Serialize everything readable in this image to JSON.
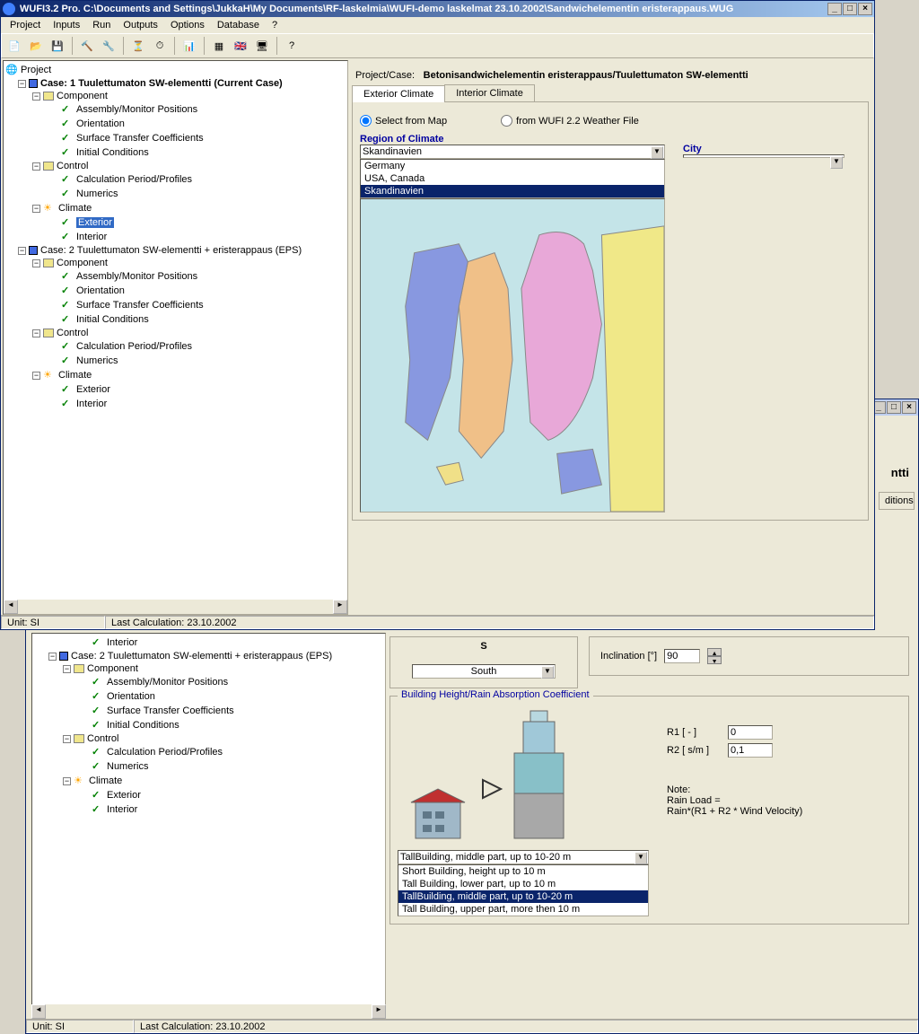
{
  "window1": {
    "title": "WUFI3.2 Pro.    C:\\Documents and Settings\\JukkaH\\My Documents\\RF-laskelmia\\WUFI-demo laskelmat 23.10.2002\\Sandwichelementin eristerappaus.WUG",
    "menu": [
      "Project",
      "Inputs",
      "Run",
      "Outputs",
      "Options",
      "Database",
      "?"
    ],
    "tree": {
      "root": "Project",
      "case1": {
        "label": "Case: 1 Tuulettumaton SW-elementti  (Current Case)",
        "component": {
          "label": "Component",
          "items": [
            "Assembly/Monitor Positions",
            "Orientation",
            "Surface Transfer Coefficients",
            "Initial Conditions"
          ]
        },
        "control": {
          "label": "Control",
          "items": [
            "Calculation Period/Profiles",
            "Numerics"
          ]
        },
        "climate": {
          "label": "Climate",
          "items": [
            "Exterior",
            "Interior"
          ]
        }
      },
      "case2": {
        "label": "Case: 2 Tuulettumaton SW-elementti + eristerappaus (EPS)",
        "component": {
          "label": "Component",
          "items": [
            "Assembly/Monitor Positions",
            "Orientation",
            "Surface Transfer Coefficients",
            "Initial Conditions"
          ]
        },
        "control": {
          "label": "Control",
          "items": [
            "Calculation Period/Profiles",
            "Numerics"
          ]
        },
        "climate": {
          "label": "Climate",
          "items": [
            "Exterior",
            "Interior"
          ]
        }
      }
    },
    "projectCase": {
      "prefix": "Project/Case:",
      "value": "Betonisandwichelementin eristerappaus/Tuulettumaton SW-elementti"
    },
    "tabs": {
      "exterior": "Exterior Climate",
      "interior": "Interior Climate"
    },
    "radio": {
      "map": "Select from Map",
      "file": "from WUFI 2.2 Weather File"
    },
    "region": {
      "label": "Region of Climate",
      "selected": "Skandinavien",
      "options": [
        "Germany",
        "USA, Canada",
        "Skandinavien"
      ]
    },
    "city": {
      "label": "City",
      "selected": ""
    },
    "status": {
      "unit": "Unit:  SI",
      "lastCalc": "Last Calculation: 23.10.2002"
    }
  },
  "window2": {
    "tree": {
      "interior": "Interior",
      "case2": {
        "label": "Case: 2 Tuulettumaton SW-elementti + eristerappaus (EPS)",
        "component": {
          "label": "Component",
          "items": [
            "Assembly/Monitor Positions",
            "Orientation",
            "Surface Transfer Coefficients",
            "Initial Conditions"
          ]
        },
        "control": {
          "label": "Control",
          "items": [
            "Calculation Period/Profiles",
            "Numerics"
          ]
        },
        "climate": {
          "label": "Climate",
          "items": [
            "Exterior",
            "Interior"
          ]
        }
      }
    },
    "compassLabel": "S",
    "direction": {
      "selected": "South"
    },
    "inclination": {
      "label": "Inclination [°]",
      "value": "90"
    },
    "buildingSection": {
      "title": "Building Height/Rain Absorption Coefficient",
      "r1label": "R1 [ - ]",
      "r1value": "0",
      "r2label": "R2 [ s/m ]",
      "r2value": "0,1",
      "noteLabel": "Note:",
      "noteLine1": "Rain Load =",
      "noteLine2": "Rain*(R1 + R2 * Wind Velocity)",
      "heightSelected": "TallBuilding, middle part, up to 10-20 m",
      "heightOptions": [
        "Short Building, height up to 10 m",
        "Tall Building, lower part, up to 10 m",
        "TallBuilding, middle part, up to 10-20 m",
        "Tall Building, upper part, more then 10 m"
      ]
    },
    "visibleTab": "ditions",
    "visibleHeader": "ntti",
    "status": {
      "unit": "Unit:  SI",
      "lastCalc": "Last Calculation: 23.10.2002"
    }
  }
}
